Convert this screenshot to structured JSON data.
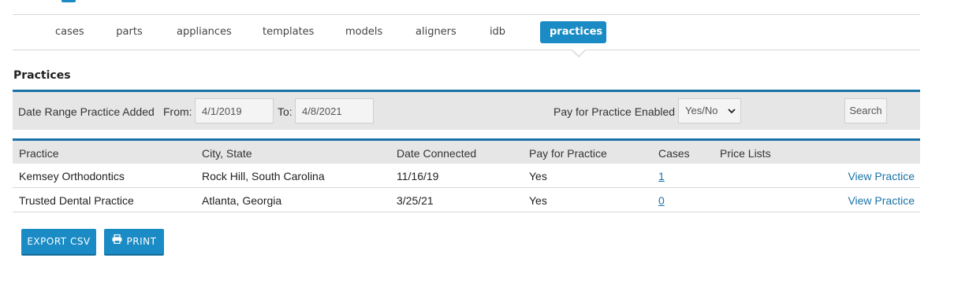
{
  "nav": {
    "tabs": [
      {
        "label": "cases"
      },
      {
        "label": "parts"
      },
      {
        "label": "appliances"
      },
      {
        "label": "templates"
      },
      {
        "label": "models"
      },
      {
        "label": "aligners"
      },
      {
        "label": "idb"
      },
      {
        "label": "practices",
        "active": true
      }
    ]
  },
  "page": {
    "title": "Practices"
  },
  "filters": {
    "date_range_label": "Date Range Practice Added",
    "from_label": "From:",
    "from_value": "4/1/2019",
    "to_label": "To:",
    "to_value": "4/8/2021",
    "pay_label": "Pay for Practice Enabled",
    "pay_select_value": "Yes/No",
    "search_label": "Search"
  },
  "table": {
    "headers": [
      "Practice",
      "City, State",
      "Date Connected",
      "Pay for Practice",
      "Cases",
      "Price Lists"
    ],
    "rows": [
      {
        "practice": "Kemsey Orthodontics",
        "city_state": "Rock Hill, South Carolina",
        "date_connected": "11/16/19",
        "pay_for_practice": "Yes",
        "cases": "1",
        "price_lists": "",
        "action": "View Practice"
      },
      {
        "practice": "Trusted Dental Practice",
        "city_state": "Atlanta, Georgia",
        "date_connected": "3/25/21",
        "pay_for_practice": "Yes",
        "cases": "0",
        "price_lists": "",
        "action": "View Practice"
      }
    ]
  },
  "actions": {
    "export_label": "EXPORT CSV",
    "print_label": "PRINT",
    "print_icon": "print-icon"
  },
  "colors": {
    "accent": "#1a8bc4",
    "bar_border": "#1a73a8",
    "bar_bg": "#e6e6e6"
  }
}
